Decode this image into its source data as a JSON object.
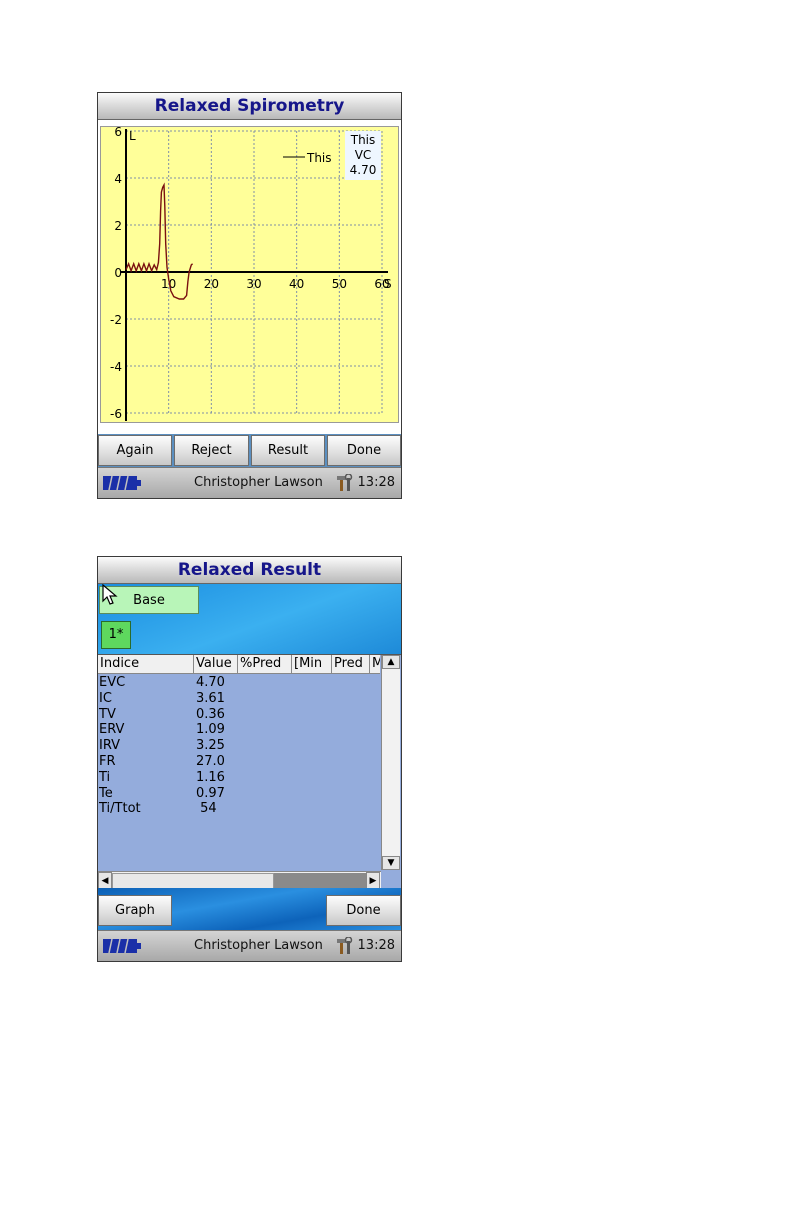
{
  "spirometry_screen": {
    "title": "Relaxed Spirometry",
    "legend": {
      "line_label": "This",
      "box_lines": [
        "This",
        "VC",
        "4.70"
      ]
    },
    "buttons": [
      "Again",
      "Reject",
      "Result",
      "Done"
    ],
    "status": {
      "user": "Christopher Lawson",
      "time": "13:28"
    },
    "chart_data": {
      "type": "line",
      "x_label": "S",
      "y_label": "L",
      "x_ticks": [
        "10",
        "20",
        "30",
        "40",
        "50",
        "60"
      ],
      "y_ticks": [
        "6",
        "4",
        "2",
        "0",
        "-2",
        "-4",
        "-6"
      ],
      "xlim": [
        0,
        60
      ],
      "ylim": [
        -6,
        6
      ],
      "grid": true,
      "series": [
        {
          "name": "This",
          "points": [
            [
              0,
              0.1
            ],
            [
              0.6,
              0.35
            ],
            [
              1.2,
              0.05
            ],
            [
              1.8,
              0.35
            ],
            [
              2.4,
              0.05
            ],
            [
              3.0,
              0.35
            ],
            [
              3.6,
              0.05
            ],
            [
              4.2,
              0.35
            ],
            [
              4.8,
              0.05
            ],
            [
              5.4,
              0.35
            ],
            [
              6.0,
              0.05
            ],
            [
              6.6,
              0.3
            ],
            [
              7.2,
              0.1
            ],
            [
              7.6,
              0.4
            ],
            [
              7.9,
              1.2
            ],
            [
              8.1,
              2.6
            ],
            [
              8.3,
              3.4
            ],
            [
              8.6,
              3.6
            ],
            [
              8.9,
              3.7
            ],
            [
              9.1,
              2.8
            ],
            [
              9.3,
              1.2
            ],
            [
              9.6,
              0.2
            ],
            [
              10.0,
              -0.3
            ],
            [
              10.5,
              -0.8
            ],
            [
              11.2,
              -1.05
            ],
            [
              12.5,
              -1.15
            ],
            [
              13.5,
              -1.15
            ],
            [
              14.2,
              -1.0
            ],
            [
              14.5,
              -0.4
            ],
            [
              14.8,
              0.0
            ],
            [
              15.3,
              0.3
            ],
            [
              15.6,
              0.35
            ]
          ]
        }
      ]
    }
  },
  "result_screen": {
    "title": "Relaxed Result",
    "base_label": "Base",
    "trial_label": "1*",
    "columns": [
      "Indice",
      "Value",
      "%Pred",
      "[Min",
      "Pred",
      "M"
    ],
    "rows": [
      {
        "name": "EVC",
        "value": "4.70"
      },
      {
        "name": "IC",
        "value": "3.61"
      },
      {
        "name": "TV",
        "value": "0.36"
      },
      {
        "name": "ERV",
        "value": "1.09"
      },
      {
        "name": "IRV",
        "value": "3.25"
      },
      {
        "name": "FR",
        "value": "27.0"
      },
      {
        "name": "Ti",
        "value": "1.16"
      },
      {
        "name": "Te",
        "value": "0.97"
      },
      {
        "name": "Ti/Ttot",
        "value": " 54"
      }
    ],
    "buttons": {
      "left": "Graph",
      "right": "Done"
    },
    "status": {
      "user": "Christopher Lawson",
      "time": "13:28"
    }
  }
}
